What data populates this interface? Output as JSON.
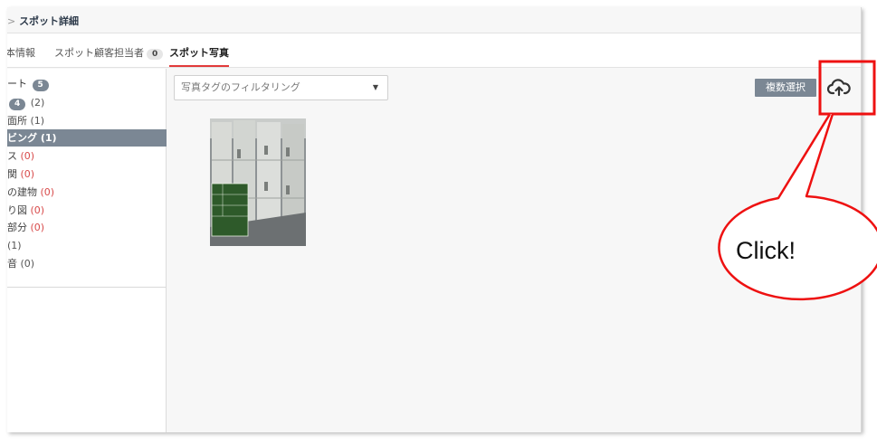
{
  "breadcrumb": {
    "separator": ">",
    "title": "スポット詳細"
  },
  "tabs": [
    {
      "label": "本情報",
      "count": ""
    },
    {
      "label": "スポット顧客担当者",
      "count": "0"
    },
    {
      "label": "スポット写真",
      "count": ""
    }
  ],
  "sidebar": {
    "header": {
      "label": "ート",
      "count": "5"
    },
    "items": [
      {
        "label": "",
        "badge": "4",
        "count": "(2)"
      },
      {
        "label": "面所",
        "count": "(1)"
      },
      {
        "label": "ビング",
        "count": "(1)"
      },
      {
        "label": "ス",
        "count": "(0)"
      },
      {
        "label": "関",
        "count": "(0)"
      },
      {
        "label": "の建物",
        "count": "(0)"
      },
      {
        "label": "り図",
        "count": "(0)"
      },
      {
        "label": "部分",
        "count": "(0)"
      },
      {
        "label": "",
        "count": "(1)"
      },
      {
        "label": "音",
        "count": "(0)"
      }
    ]
  },
  "filter": {
    "placeholder": "写真タグのフィルタリング"
  },
  "toolbar": {
    "multi_select_label": "複数選択"
  },
  "annotation": {
    "text": "Click!"
  },
  "colors": {
    "accent_red": "#e23a3a",
    "sidebar_active": "#7b8794",
    "annotation_red": "#ee1111"
  },
  "icons": {
    "upload": "cloud-upload-icon",
    "dropdown": "caret-down-icon"
  }
}
